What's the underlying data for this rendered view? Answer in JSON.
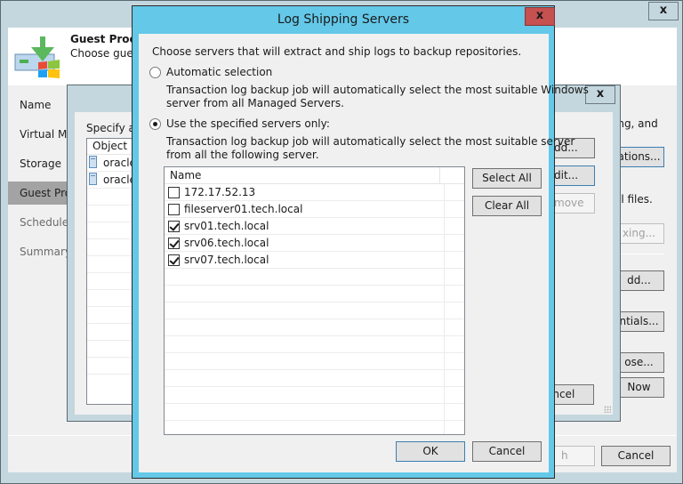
{
  "wizard": {
    "close_label": "x",
    "header_title": "Guest Processing",
    "header_subtitle": "Choose guest OS processing options available for running VMs.",
    "nav": [
      {
        "label": "Name",
        "state": "normal"
      },
      {
        "label": "Virtual Machines",
        "state": "normal"
      },
      {
        "label": "Storage",
        "state": "normal"
      },
      {
        "label": "Guest Processing",
        "state": "active"
      },
      {
        "label": "Schedule",
        "state": "dim"
      },
      {
        "label": "Summary",
        "state": "dim"
      }
    ],
    "right_text_1": "ing, and",
    "right_text_2": "al files.",
    "buttons": {
      "applications": "ations...",
      "indexing": "xing...",
      "add": "dd...",
      "credentials": "ntials...",
      "choose": "ose...",
      "test_now": "Now",
      "finish": "h",
      "cancel": "Cancel"
    }
  },
  "middle_dialog": {
    "close_label": "x",
    "instruction": "Specify application processing settings",
    "object_header": "Object",
    "objects": [
      "oracle",
      "oracle"
    ],
    "buttons": {
      "add": "dd...",
      "edit": "dit...",
      "remove": "move",
      "cancel": "ancel"
    }
  },
  "log_shipping": {
    "title": "Log Shipping Servers",
    "close_label": "x",
    "intro": "Choose servers that will extract and ship logs to backup repositories.",
    "automatic": {
      "label": "Automatic selection",
      "selected": false,
      "description_line1": "Transaction log backup job will automatically select the most suitable Windows",
      "description_line2": "server from all Managed Servers."
    },
    "specified": {
      "label": "Use the specified servers only:",
      "selected": true,
      "description_line1": "Transaction log backup job will automatically select the most suitable server",
      "description_line2": "from all the following server."
    },
    "list_header": "Name",
    "servers": [
      {
        "name": "172.17.52.13",
        "checked": false
      },
      {
        "name": "fileserver01.tech.local",
        "checked": false
      },
      {
        "name": "srv01.tech.local",
        "checked": true
      },
      {
        "name": "srv06.tech.local",
        "checked": true
      },
      {
        "name": "srv07.tech.local",
        "checked": true
      }
    ],
    "select_all": "Select All",
    "clear_all": "Clear All",
    "ok": "OK",
    "cancel": "Cancel"
  },
  "colors": {
    "dialog_frame": "#64c8e9",
    "close_button": "#c75050",
    "window_frame": "#c4d7de",
    "nav_active": "#a3a3a3"
  }
}
